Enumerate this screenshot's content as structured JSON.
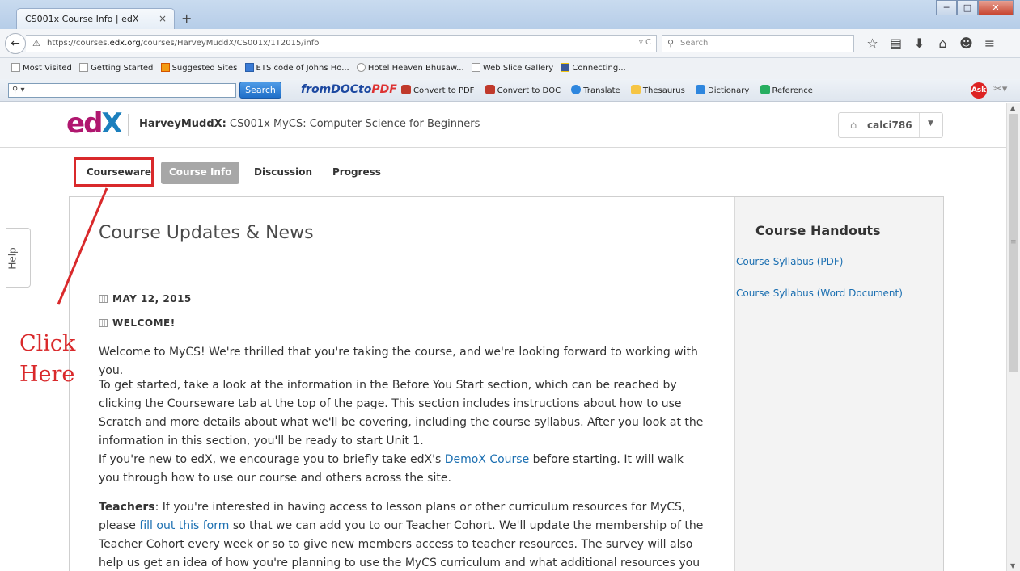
{
  "browser": {
    "tab_title": "CS001x Course Info | edX",
    "tab_close": "×",
    "new_tab": "+",
    "window_buttons": {
      "minimize": "─",
      "maximize": "□",
      "close": "✕"
    },
    "url_prefix": "https://courses.",
    "url_domain": "edx.org",
    "url_path": "/courses/HarveyMuddX/CS001x/1T2015/info",
    "url_reload": "▿ C",
    "search_placeholder": "Search",
    "bookmarks": [
      "Most Visited",
      "Getting Started",
      "Suggested Sites",
      "ETS code of Johns Ho...",
      "Hotel Heaven Bhusaw...",
      "Web Slice Gallery",
      "Connecting..."
    ],
    "toolbar": {
      "search_button": "Search",
      "logo_main": "fromDOCto",
      "logo_pdf": "PDF",
      "links": [
        "Convert to PDF",
        "Convert to DOC",
        "Translate",
        "Thesaurus",
        "Dictionary",
        "Reference"
      ],
      "ask": "Ask"
    }
  },
  "header": {
    "logo_e": "e",
    "logo_d": "d",
    "logo_x": "X",
    "course_org": "HarveyMuddX:",
    "course_name": " CS001x MyCS: Computer Science for Beginners",
    "username": "calci786",
    "caret": "▼"
  },
  "course_tabs": [
    "Courseware",
    "Course Info",
    "Discussion",
    "Progress"
  ],
  "help_label": "Help",
  "updates": {
    "title": "Course Updates & News",
    "date": "MAY 12, 2015",
    "heading": "WELCOME!",
    "p1": "Welcome to MyCS! We're thrilled that you're taking the course, and we're looking forward to working with you.",
    "p2_a": "To get started, take a look at the information in the Before You Start section, which can be reached by clicking the Courseware tab at the top of the page. This section includes instructions about how to use Scratch and more details about what we'll be covering, including the course syllabus. After you look at the information in this section, you'll be ready to start Unit 1.",
    "p3_a": "If you're new to edX, we encourage you to briefly take edX's ",
    "p3_link": "DemoX Course",
    "p3_b": " before starting. It will walk you through how to use our course and others across the site.",
    "p4_bold": "Teachers",
    "p4_a": ": If you're interested in having access to lesson plans or other curriculum resources for MyCS, please ",
    "p4_link": "fill out this form",
    "p4_b": " so that we can add you to our Teacher Cohort. We'll update the membership of the Teacher Cohort every week or so to give new members access to teacher resources. The survey will also help us get an idea of how you're planning to use the MyCS curriculum and what additional resources you might"
  },
  "handouts": {
    "title": "Course Handouts",
    "links": [
      "Course Syllabus (PDF)",
      "Course Syllabus (Word Document)"
    ]
  },
  "annotation": {
    "line1": "Click",
    "line2": "Here",
    "color": "#d9292b"
  }
}
